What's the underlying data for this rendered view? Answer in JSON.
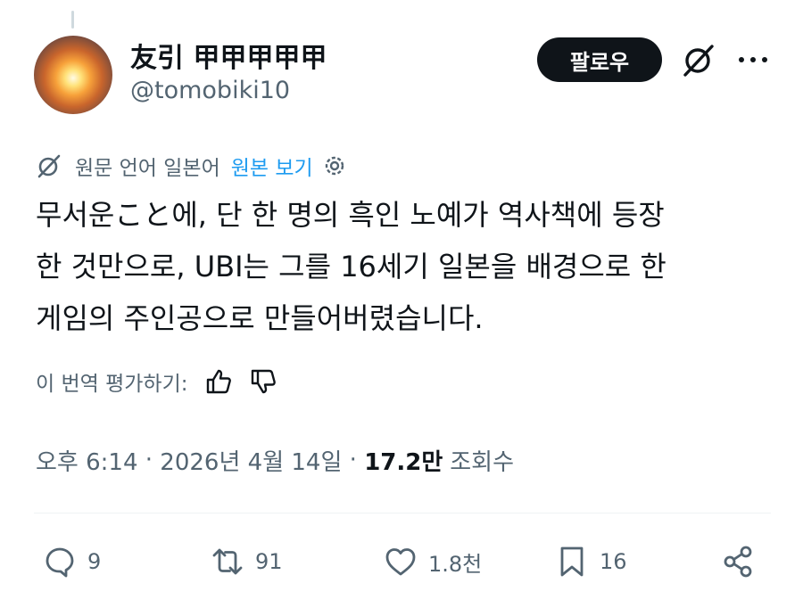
{
  "user": {
    "display_name": "友引 甲甲甲甲甲",
    "handle": "@tomobiki10"
  },
  "header": {
    "follow_label": "팔로우",
    "grok_icon": "grok-icon",
    "more_icon": "more-icon"
  },
  "translation": {
    "label": "원문 언어 일본어",
    "view_original": "원본 보기"
  },
  "tweet": {
    "lines": [
      "무서운こと에, 단 한 명의 흑인 노예가 역사책에 등장",
      "한 것만으로, UBI는 그를 16세기 일본을 배경으로 한",
      "게임의 주인공으로 만들어버렸습니다."
    ]
  },
  "rating": {
    "label": "이 번역 평가하기:"
  },
  "meta": {
    "time": "오후 6:14",
    "sep1": " · ",
    "date": "2026년 4월 14일",
    "sep2": " · ",
    "views_count": "17.2만",
    "views_label": "조회수"
  },
  "actions": {
    "replies": "9",
    "reposts": "91",
    "likes": "1.8천",
    "bookmarks": "16"
  },
  "colors": {
    "link": "#1d9bf0",
    "muted": "#536471",
    "text": "#0f1419"
  }
}
